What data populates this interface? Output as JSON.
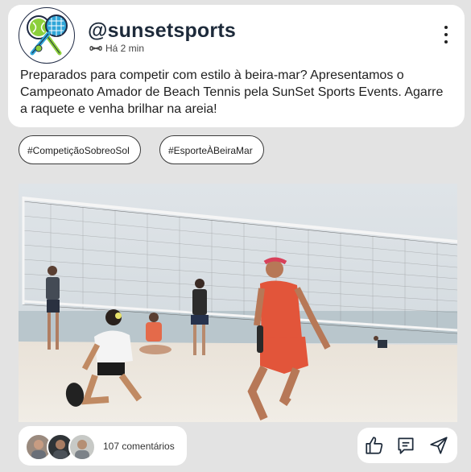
{
  "post": {
    "handle": "@sunsetsports",
    "time": "Há 2 min",
    "caption": "Preparados para competir com estilo à beira-mar? Apresentamos o Campeonato Amador de Beach Tennis pela SunSet Sports Events. Agarre a raquete e venha brilhar na areia!"
  },
  "tags": [
    "#CompetiçãoSobreoSol",
    "#EsporteÀBeiraMar"
  ],
  "footer": {
    "comments_label": "107 comentários"
  },
  "icons": {
    "avatar": "tennis-rackets-logo-icon",
    "meta": "infinity-icon",
    "menu": "more-vertical-icon",
    "like": "thumbs-up-icon",
    "comment": "comment-icon",
    "share": "send-icon"
  },
  "colors": {
    "background": "#e3e3e3",
    "card": "#ffffff",
    "handle": "#1d2a3a",
    "logo_green": "#8ccf3b",
    "logo_blue": "#2fa6d8"
  }
}
